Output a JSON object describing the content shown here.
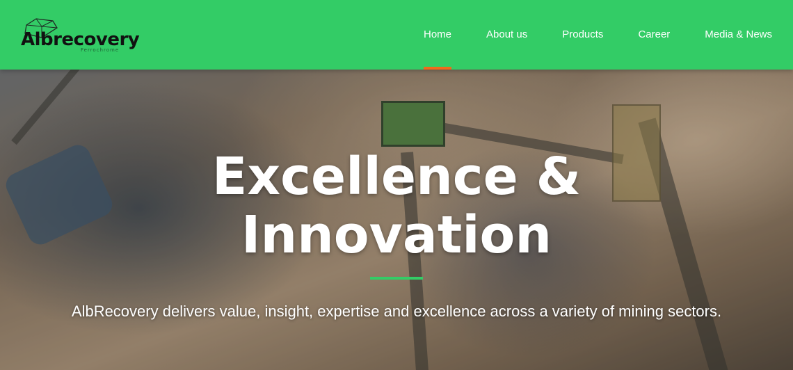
{
  "header": {
    "logo_text": "Albrecovery",
    "logo_subtext": "Ferrochrome",
    "nav": [
      {
        "label": "Home",
        "active": true
      },
      {
        "label": "About us",
        "active": false
      },
      {
        "label": "Products",
        "active": false
      },
      {
        "label": "Career",
        "active": false
      },
      {
        "label": "Media & News",
        "active": false
      }
    ]
  },
  "hero": {
    "title_line1": "Excellence &",
    "title_line2": "Innovation",
    "subtitle": "AlbRecovery delivers value, insight, expertise and excellence across a variety of mining sectors."
  },
  "colors": {
    "header_bg": "#33cc66",
    "active_indicator": "#f06a1a",
    "divider": "#33cc66"
  },
  "icons": {
    "logo": "diamond-outline-icon"
  }
}
